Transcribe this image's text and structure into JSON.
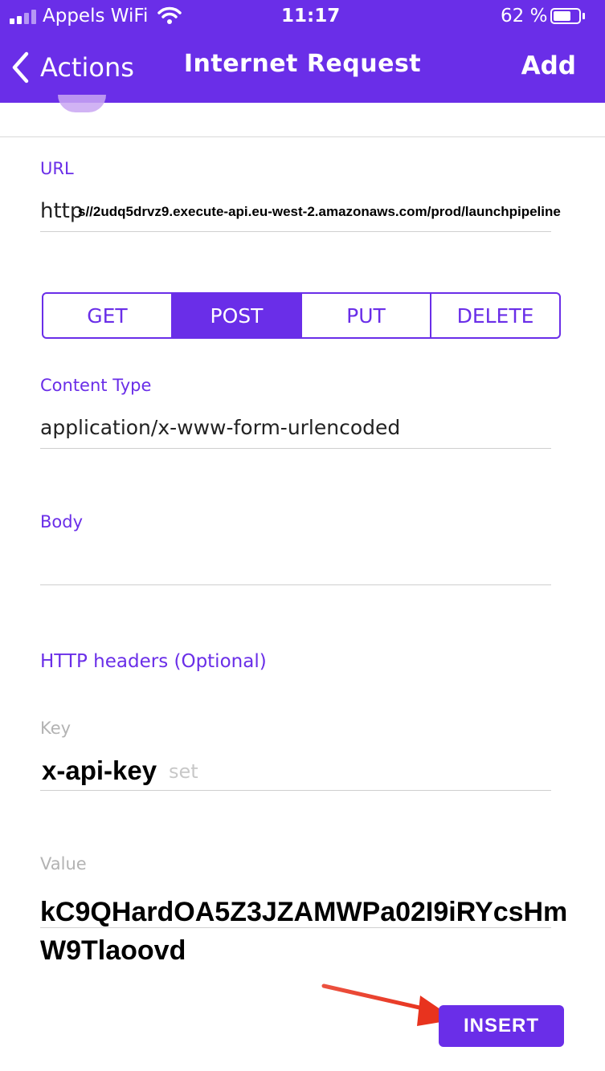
{
  "status_bar": {
    "carrier": "Appels WiFi",
    "time": "11:17",
    "battery": "62 %"
  },
  "nav": {
    "back_label": "Actions",
    "title": "Internet Request",
    "add_label": "Add"
  },
  "url": {
    "label": "URL",
    "prefix": "http",
    "rest": "s//2udq5drvz9.execute-api.eu-west-2.amazonaws.com/prod/launchpipeline"
  },
  "methods": {
    "items": [
      "GET",
      "POST",
      "PUT",
      "DELETE"
    ],
    "selected": "POST"
  },
  "content_type": {
    "label": "Content Type",
    "value": "application/x-www-form-urlencoded"
  },
  "body": {
    "label": "Body",
    "value": ""
  },
  "headers": {
    "label": "HTTP headers (Optional)",
    "key_label": "Key",
    "key_value": "x-api-key",
    "key_placeholder_tail": "set",
    "value_label": "Value",
    "value_value": "kC9QHardOA5Z3JZAMWPa02I9iRYcsHmW9Tlaoovd"
  },
  "insert_button": {
    "label": "INSERT"
  },
  "colors": {
    "accent": "#6a2ee8",
    "arrow": "#e8331e"
  }
}
